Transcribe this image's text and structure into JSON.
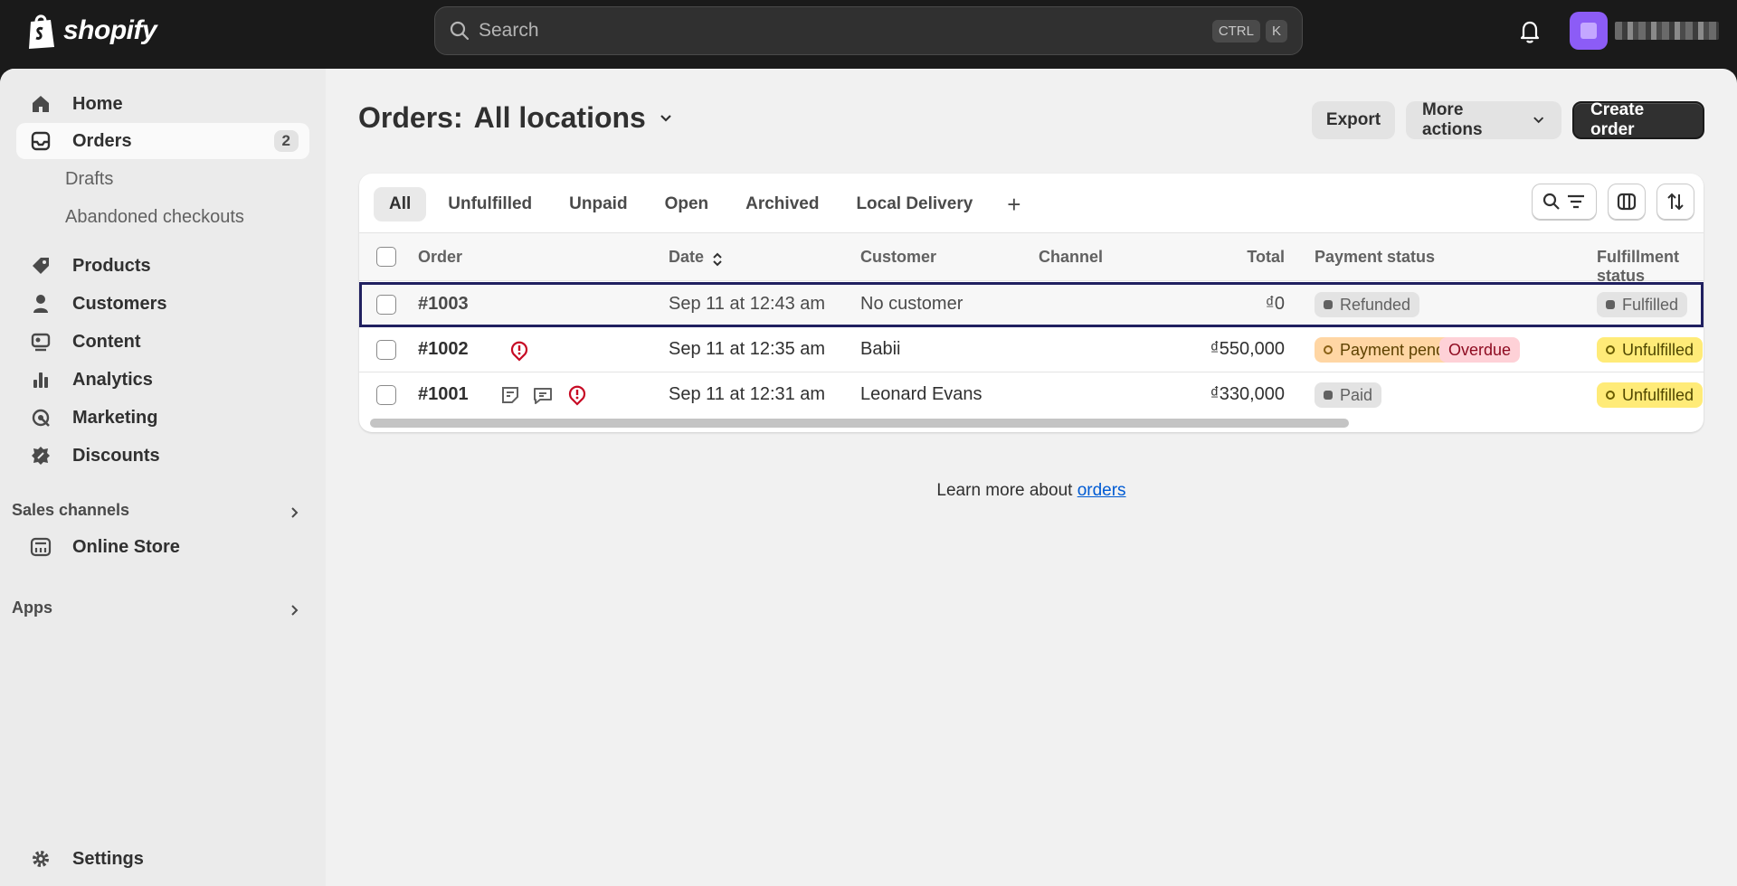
{
  "topbar": {
    "logo_text": "shopify",
    "search_placeholder": "Search",
    "shortcut_keys": [
      "CTRL",
      "K"
    ]
  },
  "sidebar": {
    "items": [
      {
        "label": "Home",
        "icon": "home-icon"
      },
      {
        "label": "Orders",
        "icon": "orders-icon",
        "count": "2"
      },
      {
        "label": "Drafts"
      },
      {
        "label": "Abandoned checkouts"
      },
      {
        "label": "Products",
        "icon": "tag-icon"
      },
      {
        "label": "Customers",
        "icon": "person-icon"
      },
      {
        "label": "Content",
        "icon": "content-icon"
      },
      {
        "label": "Analytics",
        "icon": "bar-chart-icon"
      },
      {
        "label": "Marketing",
        "icon": "target-icon"
      },
      {
        "label": "Discounts",
        "icon": "discount-icon"
      }
    ],
    "sales_channels_label": "Sales channels",
    "online_store_label": "Online Store",
    "apps_label": "Apps",
    "settings_label": "Settings"
  },
  "page": {
    "title_prefix": "Orders:",
    "title_location": "All locations",
    "export_label": "Export",
    "more_actions_label": "More actions",
    "create_order_label": "Create order"
  },
  "tabs": [
    "All",
    "Unfulfilled",
    "Unpaid",
    "Open",
    "Archived",
    "Local Delivery"
  ],
  "table": {
    "headers": {
      "order": "Order",
      "date": "Date",
      "customer": "Customer",
      "channel": "Channel",
      "total": "Total",
      "payment_status": "Payment status",
      "fulfillment_status": "Fulfillment status"
    },
    "rows": [
      {
        "order": "#1003",
        "date": "Sep 11 at 12:43 am",
        "customer": "No customer",
        "channel": "",
        "total": "₫0",
        "payment": "Refunded",
        "fulfillment": "Fulfilled"
      },
      {
        "order": "#1002",
        "date": "Sep 11 at 12:35 am",
        "customer": "Babii",
        "channel": "",
        "total": "₫550,000",
        "payment": "Payment pending",
        "payment_extra": "Overdue",
        "fulfillment": "Unfulfilled"
      },
      {
        "order": "#1001",
        "date": "Sep 11 at 12:31 am",
        "customer": "Leonard Evans",
        "channel": "",
        "total": "₫330,000",
        "payment": "Paid",
        "fulfillment": "Unfulfilled"
      }
    ]
  },
  "footer": {
    "learn_text": "Learn more about",
    "learn_link": "orders"
  },
  "colors": {
    "topbar_bg": "#1a1a1a",
    "primary_button": "#303030",
    "avatar": "#8c5cf6",
    "link": "#005bd3",
    "alert_icon": "#c70a24"
  }
}
